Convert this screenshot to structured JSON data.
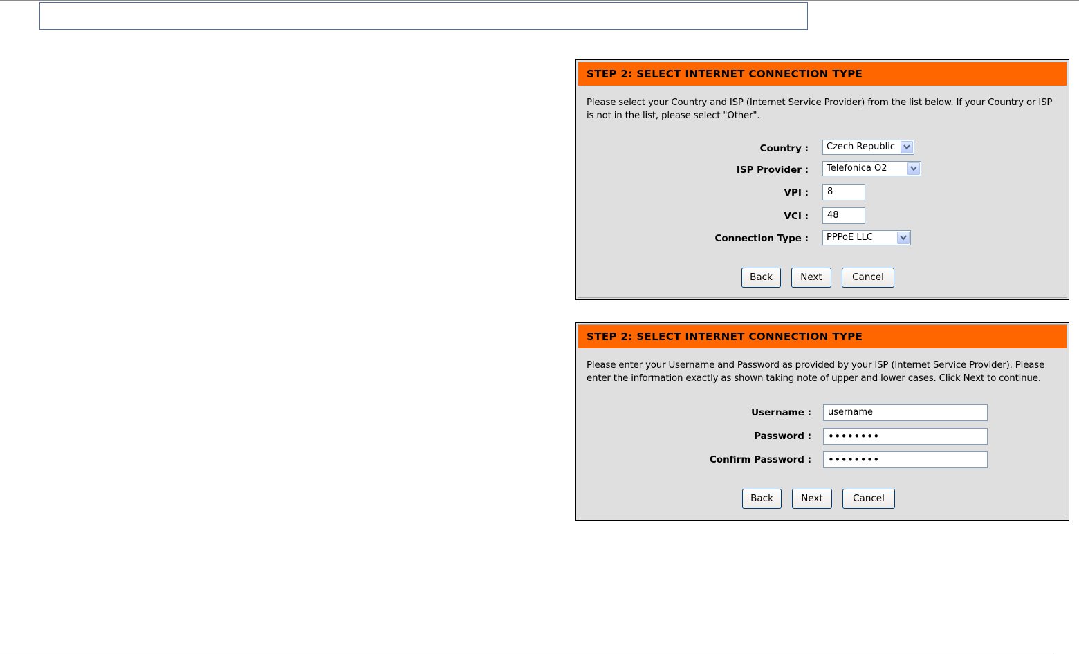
{
  "panel1": {
    "title": "STEP 2: SELECT INTERNET CONNECTION TYPE",
    "description": "Please select your Country and ISP (Internet Service Provider) from the list below. If your Country or ISP is not in the list, please select \"Other\".",
    "country_label": "Country :",
    "country_value": "Czech Republic",
    "isp_label": "ISP Provider :",
    "isp_value": "Telefonica O2",
    "vpi_label": "VPI :",
    "vpi_value": "8",
    "vci_label": "VCI :",
    "vci_value": "48",
    "connection_type_label": "Connection Type :",
    "connection_type_value": "PPPoE LLC",
    "back_label": "Back",
    "next_label": "Next",
    "cancel_label": "Cancel"
  },
  "panel2": {
    "title": "STEP 2: SELECT INTERNET CONNECTION TYPE",
    "description": "Please enter your Username and Password as provided by your ISP (Internet Service Provider). Please enter the information exactly as shown taking note of upper and lower cases. Click Next to continue.",
    "username_label": "Username :",
    "username_value": "username",
    "password_label": "Password :",
    "password_value": "••••••••",
    "confirm_label": "Confirm Password :",
    "confirm_value": "••••••••",
    "back_label": "Back",
    "next_label": "Next",
    "cancel_label": "Cancel"
  },
  "colors": {
    "title_bar": "#ff6600",
    "panel_bg": "#dfdfdf",
    "input_border": "#7f9db9"
  }
}
